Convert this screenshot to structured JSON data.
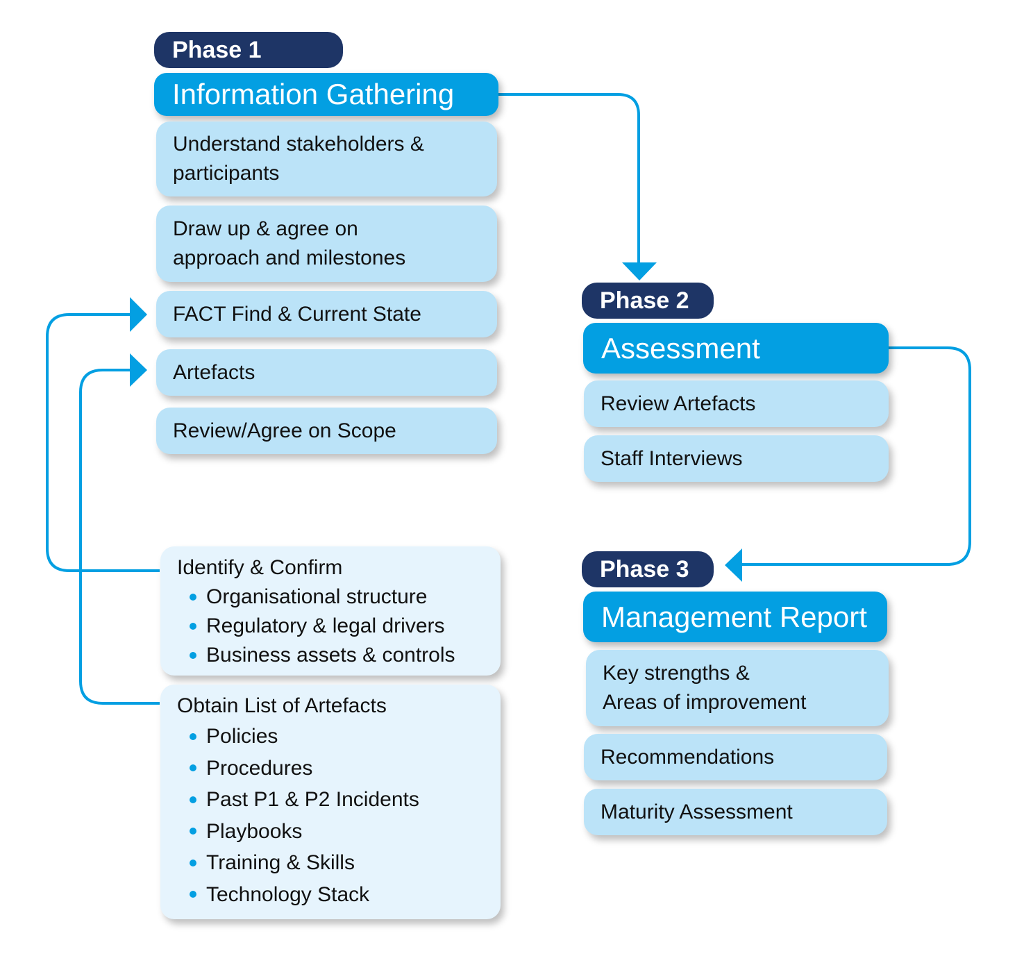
{
  "colors": {
    "phase_pill": "#1e3566",
    "phase_title": "#039fe2",
    "step_box": "#bbe3f8",
    "panel_box": "#e6f4fd",
    "connector": "#039fe2",
    "bullet": "#039fe2"
  },
  "phases": [
    {
      "pill": "Phase 1",
      "title": "Information Gathering",
      "steps": [
        "Understand stakeholders &\nparticipants",
        "Draw up & agree on\napproach and milestones",
        "FACT Find & Current State",
        "Artefacts",
        "Review/Agree on Scope"
      ]
    },
    {
      "pill": "Phase 2",
      "title": "Assessment",
      "steps": [
        "Review Artefacts",
        "Staff Interviews"
      ]
    },
    {
      "pill": "Phase 3",
      "title": "Management Report",
      "steps": [
        "Key strengths &\nAreas of improvement",
        "Recommendations",
        "Maturity Assessment"
      ]
    }
  ],
  "panels": [
    {
      "title": "Identify & Confirm",
      "items": [
        "Organisational structure",
        "Regulatory & legal drivers",
        "Business assets & controls"
      ]
    },
    {
      "title": "Obtain List of Artefacts",
      "items": [
        "Policies",
        "Procedures",
        "Past P1 & P2 Incidents",
        "Playbooks",
        "Training & Skills",
        "Technology Stack"
      ]
    }
  ],
  "connectors": [
    {
      "from": "Information Gathering",
      "to": "Phase 2",
      "icon": "arrow-down-icon"
    },
    {
      "from": "Assessment",
      "to": "Phase 3",
      "icon": "arrow-left-icon"
    },
    {
      "from": "Identify & Confirm",
      "to": "FACT Find & Current State",
      "icon": "arrow-right-icon"
    },
    {
      "from": "Obtain List of Artefacts",
      "to": "Artefacts",
      "icon": "arrow-right-icon"
    }
  ]
}
